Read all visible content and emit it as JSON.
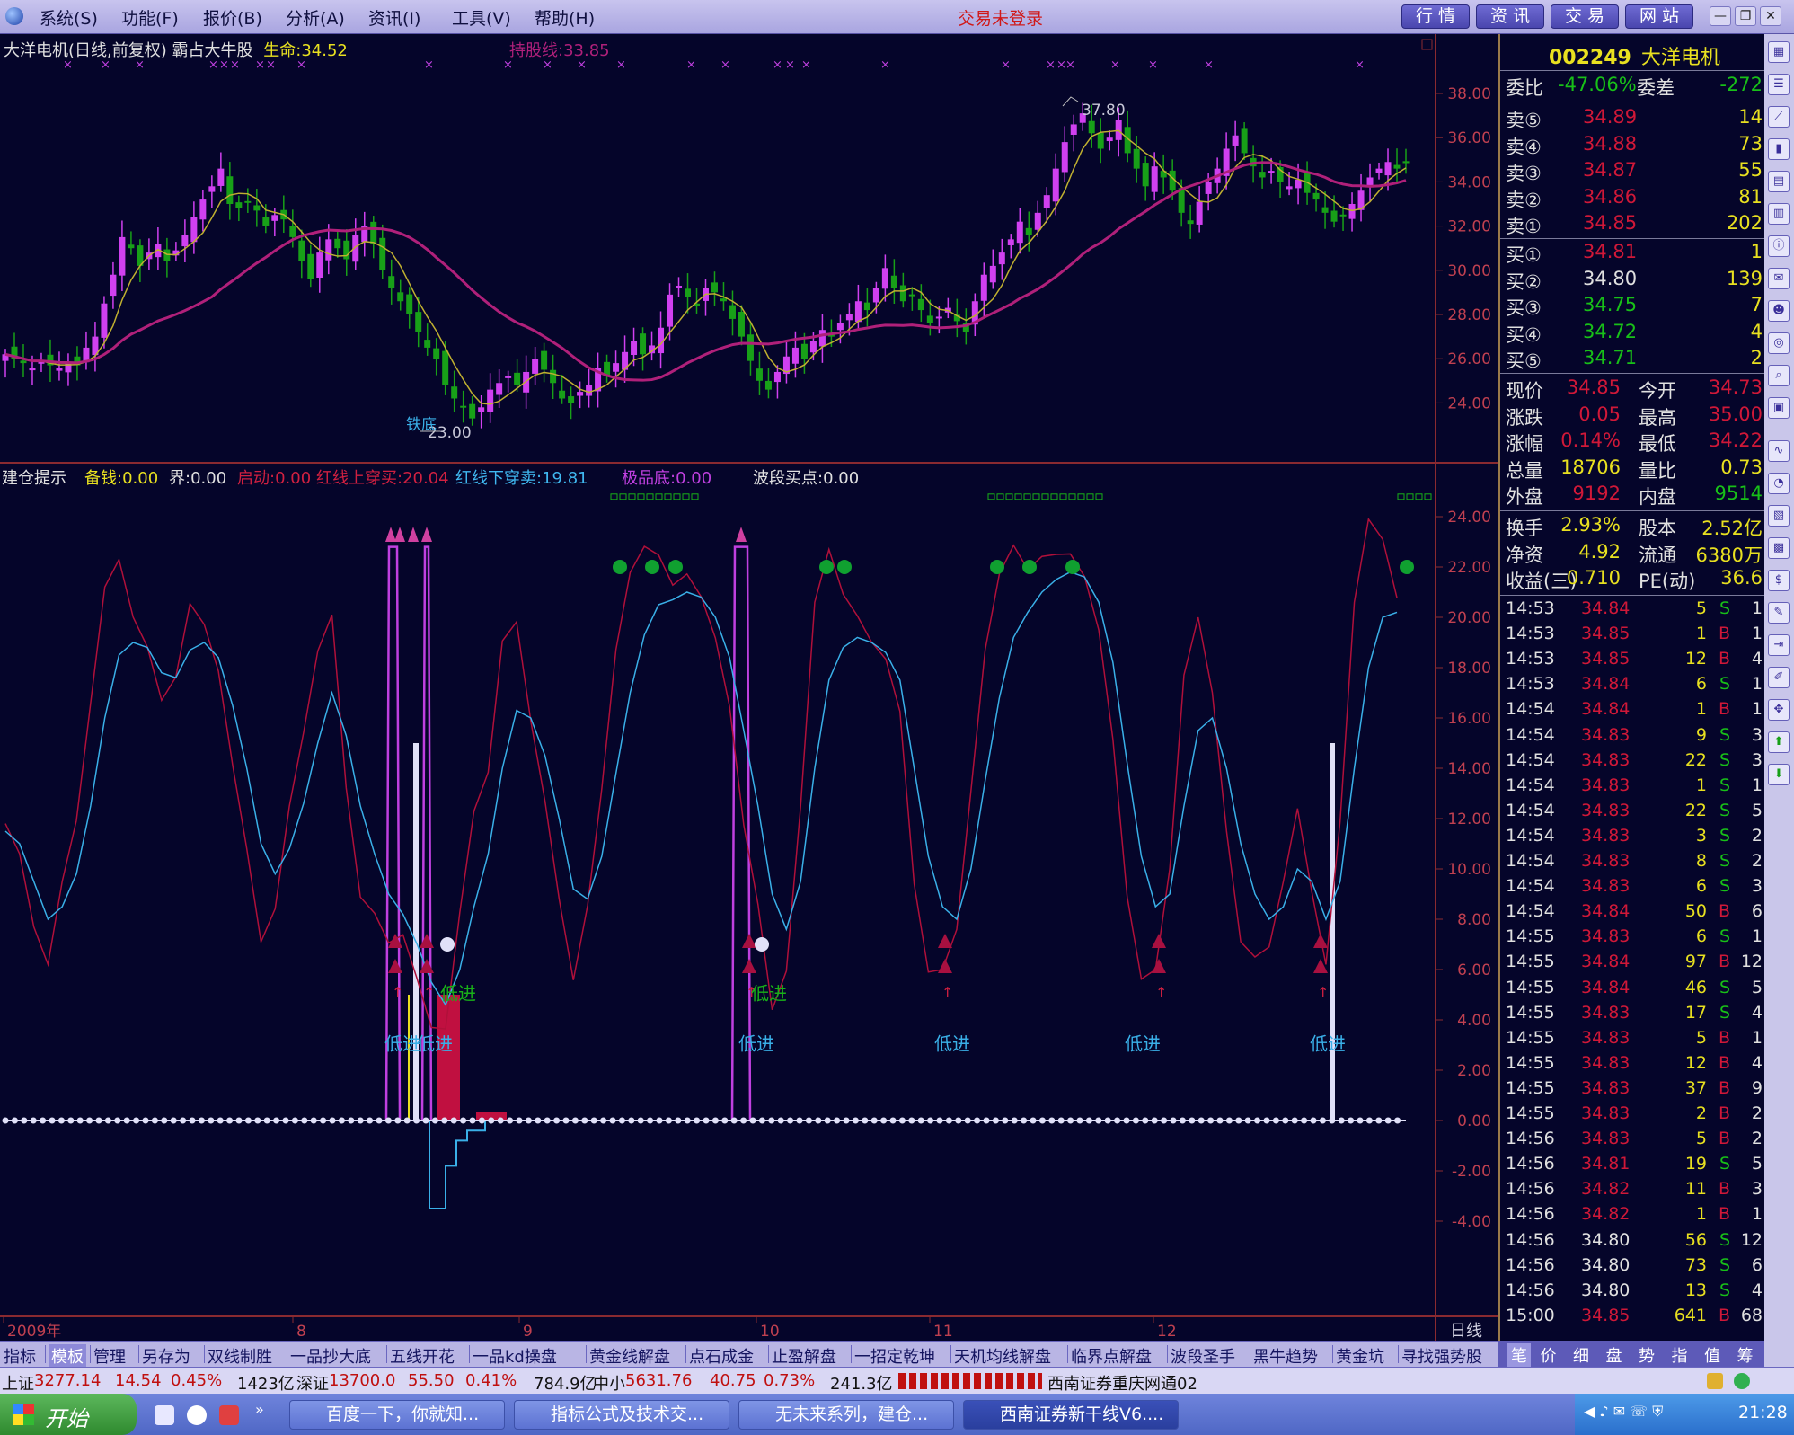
{
  "menu": {
    "items": [
      "系统(S)",
      "功能(F)",
      "报价(B)",
      "分析(A)",
      "资讯(I)",
      "工具(V)",
      "帮助(H)"
    ],
    "login_status": "交易未登录",
    "buttons": [
      "行 情",
      "资 讯",
      "交 易",
      "网 站"
    ]
  },
  "kline": {
    "header": {
      "title": "大洋电机(日线,前复权) 霸占大牛股",
      "life_label": "生命:",
      "life_value": "34.52",
      "hold_label": "持股线:",
      "hold_value": "33.85"
    },
    "high_label": "37.80",
    "low_label": "23.00",
    "bottom_marker": "铁底",
    "y_ticks": [
      "38.00",
      "36.00",
      "34.00",
      "32.00",
      "30.00",
      "28.00",
      "26.00",
      "24.00"
    ]
  },
  "indicator": {
    "header": [
      {
        "label": "建仓提示",
        "color": "#e0e0e0"
      },
      {
        "label": "备钱:0.00",
        "color": "#e8e020"
      },
      {
        "label": "界:0.00",
        "color": "#e0e0e0"
      },
      {
        "label": "启动:0.00",
        "color": "#d02040"
      },
      {
        "label": "红线上穿买:20.04",
        "color": "#d02040"
      },
      {
        "label": "红线下穿卖:19.81",
        "color": "#40b8f0"
      },
      {
        "label": "极品底:0.00",
        "color": "#c040e0"
      },
      {
        "label": "波段买点:0.00",
        "color": "#e0e0e0"
      }
    ],
    "y_ticks": [
      "24.00",
      "22.00",
      "20.00",
      "18.00",
      "16.00",
      "14.00",
      "12.00",
      "10.00",
      "8.00",
      "6.00",
      "4.00",
      "2.00",
      "0.00",
      "-2.00",
      "-4.00"
    ],
    "signal_low_in": "低进",
    "signal_low_in_green": "低进"
  },
  "x_axis": {
    "labels": [
      "2009年",
      "8",
      "9",
      "10",
      "11",
      "12"
    ],
    "period": "日线"
  },
  "quote": {
    "code": "002249",
    "name": "大洋电机",
    "weibi_label": "委比",
    "weibi_value": "-47.06%",
    "weicha_label": "委差",
    "weicha_value": "-272",
    "sells": [
      {
        "label": "卖⑤",
        "price": "34.89",
        "vol": "14"
      },
      {
        "label": "卖④",
        "price": "34.88",
        "vol": "73"
      },
      {
        "label": "卖③",
        "price": "34.87",
        "vol": "55"
      },
      {
        "label": "卖②",
        "price": "34.86",
        "vol": "81"
      },
      {
        "label": "卖①",
        "price": "34.85",
        "vol": "202"
      }
    ],
    "buys": [
      {
        "label": "买①",
        "price": "34.81",
        "vol": "1"
      },
      {
        "label": "买②",
        "price": "34.80",
        "vol": "139"
      },
      {
        "label": "买③",
        "price": "34.75",
        "vol": "7"
      },
      {
        "label": "买④",
        "price": "34.72",
        "vol": "4"
      },
      {
        "label": "买⑤",
        "price": "34.71",
        "vol": "2"
      }
    ],
    "stats": [
      {
        "l1": "现价",
        "v1": "34.85",
        "l2": "今开",
        "v2": "34.73"
      },
      {
        "l1": "涨跌",
        "v1": "0.05",
        "l2": "最高",
        "v2": "35.00"
      },
      {
        "l1": "涨幅",
        "v1": "0.14%",
        "l2": "最低",
        "v2": "34.22"
      },
      {
        "l1": "总量",
        "v1": "18706",
        "l2": "量比",
        "v2": "0.73"
      },
      {
        "l1": "外盘",
        "v1": "9192",
        "l2": "内盘",
        "v2": "9514"
      }
    ],
    "stats2": [
      {
        "l1": "换手",
        "v1": "2.93%",
        "l2": "股本",
        "v2": "2.52亿"
      },
      {
        "l1": "净资",
        "v1": "4.92",
        "l2": "流通",
        "v2": "6380万"
      },
      {
        "l1": "收益(三)",
        "v1": "0.710",
        "l2": "PE(动)",
        "v2": "36.6"
      }
    ],
    "ticks": [
      {
        "t": "14:53",
        "p": "34.84",
        "v": "5",
        "bs": "S",
        "n": "1"
      },
      {
        "t": "14:53",
        "p": "34.85",
        "v": "1",
        "bs": "B",
        "n": "1"
      },
      {
        "t": "14:53",
        "p": "34.85",
        "v": "12",
        "bs": "B",
        "n": "4"
      },
      {
        "t": "14:53",
        "p": "34.84",
        "v": "6",
        "bs": "S",
        "n": "1"
      },
      {
        "t": "14:54",
        "p": "34.84",
        "v": "1",
        "bs": "B",
        "n": "1"
      },
      {
        "t": "14:54",
        "p": "34.83",
        "v": "9",
        "bs": "S",
        "n": "3"
      },
      {
        "t": "14:54",
        "p": "34.83",
        "v": "22",
        "bs": "S",
        "n": "3"
      },
      {
        "t": "14:54",
        "p": "34.83",
        "v": "1",
        "bs": "S",
        "n": "1"
      },
      {
        "t": "14:54",
        "p": "34.83",
        "v": "22",
        "bs": "S",
        "n": "5"
      },
      {
        "t": "14:54",
        "p": "34.83",
        "v": "3",
        "bs": "S",
        "n": "2"
      },
      {
        "t": "14:54",
        "p": "34.83",
        "v": "8",
        "bs": "S",
        "n": "2"
      },
      {
        "t": "14:54",
        "p": "34.83",
        "v": "6",
        "bs": "S",
        "n": "3"
      },
      {
        "t": "14:54",
        "p": "34.84",
        "v": "50",
        "bs": "B",
        "n": "6"
      },
      {
        "t": "14:55",
        "p": "34.83",
        "v": "6",
        "bs": "S",
        "n": "1"
      },
      {
        "t": "14:55",
        "p": "34.84",
        "v": "97",
        "bs": "B",
        "n": "12"
      },
      {
        "t": "14:55",
        "p": "34.84",
        "v": "46",
        "bs": "S",
        "n": "5"
      },
      {
        "t": "14:55",
        "p": "34.83",
        "v": "17",
        "bs": "S",
        "n": "4"
      },
      {
        "t": "14:55",
        "p": "34.83",
        "v": "5",
        "bs": "B",
        "n": "1"
      },
      {
        "t": "14:55",
        "p": "34.83",
        "v": "12",
        "bs": "B",
        "n": "4"
      },
      {
        "t": "14:55",
        "p": "34.83",
        "v": "37",
        "bs": "B",
        "n": "9"
      },
      {
        "t": "14:55",
        "p": "34.83",
        "v": "2",
        "bs": "B",
        "n": "2"
      },
      {
        "t": "14:56",
        "p": "34.83",
        "v": "5",
        "bs": "B",
        "n": "2"
      },
      {
        "t": "14:56",
        "p": "34.81",
        "v": "19",
        "bs": "S",
        "n": "5"
      },
      {
        "t": "14:56",
        "p": "34.82",
        "v": "11",
        "bs": "B",
        "n": "3"
      },
      {
        "t": "14:56",
        "p": "34.82",
        "v": "1",
        "bs": "B",
        "n": "1"
      },
      {
        "t": "14:56",
        "p": "34.80",
        "v": "56",
        "bs": "S",
        "n": "12"
      },
      {
        "t": "14:56",
        "p": "34.80",
        "v": "73",
        "bs": "S",
        "n": "6"
      },
      {
        "t": "14:56",
        "p": "34.80",
        "v": "13",
        "bs": "S",
        "n": "4"
      },
      {
        "t": "15:00",
        "p": "34.85",
        "v": "641",
        "bs": "B",
        "n": "68"
      }
    ]
  },
  "tabs": [
    "指标",
    "模板",
    "管理",
    "另存为",
    "双线制胜",
    "一品抄大底",
    "五线开花",
    "一品kd操盘",
    "黄金线解盘",
    "点石成金",
    "止盈解盘",
    "一招定乾坤",
    "天机均线解盘",
    "临界点解盘",
    "波段圣手",
    "黑牛趋势",
    "黄金坑",
    "寻找强势股"
  ],
  "right_tabs": [
    "笔",
    "价",
    "细",
    "盘",
    "势",
    "指",
    "值",
    "筹"
  ],
  "status": {
    "sh_label": "上证",
    "sh_value": "3277.14",
    "sh_change": "14.54",
    "sh_pct": "0.45%",
    "sh_amount": "1423亿",
    "sz_label": "深证",
    "sz_value": "13700.0",
    "sz_change": "55.50",
    "sz_pct": "0.41%",
    "sz_amount": "784.9亿",
    "zx_label": "中小",
    "zx_value": "5631.76",
    "zx_change": "40.75",
    "zx_pct": "0.73%",
    "zx_amount": "241.3亿",
    "server": "西南证券重庆网通02"
  },
  "taskbar": {
    "start": "开始",
    "tasks": [
      "百度一下，你就知...",
      "指标公式及技术交...",
      "无未来系列，建仓...",
      "西南证券新干线V6...."
    ],
    "time": "21:28"
  },
  "colors": {
    "up": "#d040f0",
    "down": "#18a018",
    "ma_short": "#c0b030",
    "ma_long": "#b0207a",
    "red_line": "#b0103a",
    "blue_line": "#3ab0e8",
    "background": "#05052a"
  }
}
